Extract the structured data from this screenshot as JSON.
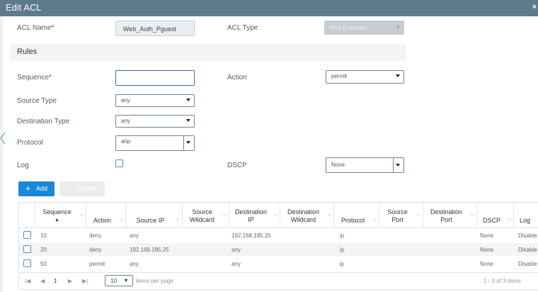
{
  "window": {
    "title": "Edit ACL",
    "close_glyph": "×"
  },
  "form": {
    "acl_name_label": "ACL Name*",
    "acl_name_value": "Web_Auth_Pguest",
    "acl_type_label": "ACL Type",
    "acl_type_value": "IPv4 Extended",
    "rules_title": "Rules",
    "sequence_label": "Sequence*",
    "sequence_value": "",
    "action_label": "Action",
    "action_value": "permit",
    "source_type_label": "Source Type",
    "source_type_value": "any",
    "destination_type_label": "Destination Type",
    "destination_type_value": "any",
    "protocol_label": "Protocol",
    "protocol_value": "ahp",
    "log_label": "Log",
    "dscp_label": "DSCP",
    "dscp_value": "None"
  },
  "buttons": {
    "add_label": "Add",
    "add_glyph": "+",
    "delete_label": "Delete",
    "delete_glyph": "×"
  },
  "table": {
    "headers": {
      "sequence": "Sequence",
      "sort_glyph": "▲",
      "action": "Action",
      "source_ip": "Source IP",
      "source_wildcard_1": "Source",
      "source_wildcard_2": "Wildcard",
      "destination_ip_1": "Destination",
      "destination_ip_2": "IP",
      "destination_wildcard_1": "Destination",
      "destination_wildcard_2": "Wildcard",
      "protocol": "Protocol",
      "source_port_1": "Source",
      "source_port_2": "Port",
      "destination_port_1": "Destination",
      "destination_port_2": "Port",
      "dscp": "DSCP",
      "log": "Log",
      "filter_glyph": "⌵"
    },
    "rows": [
      {
        "sequence": "10",
        "action": "deny",
        "source_ip": "any",
        "destination_ip": "192.168.185.25",
        "protocol": "ip",
        "dscp": "None",
        "log": "Disable"
      },
      {
        "sequence": "20",
        "action": "deny",
        "source_ip": "192.168.185.25",
        "destination_ip": "any",
        "protocol": "ip",
        "dscp": "None",
        "log": "Disable"
      },
      {
        "sequence": "50",
        "action": "permit",
        "source_ip": "any",
        "destination_ip": "any",
        "protocol": "ip",
        "dscp": "None",
        "log": "Disable"
      }
    ]
  },
  "pager": {
    "first": "|◀",
    "prev": "◀",
    "page": "1",
    "next": "▶",
    "last": "▶|",
    "per_page": "10",
    "per_page_label": "items per page",
    "summary": "1 - 3 of 3 items"
  }
}
